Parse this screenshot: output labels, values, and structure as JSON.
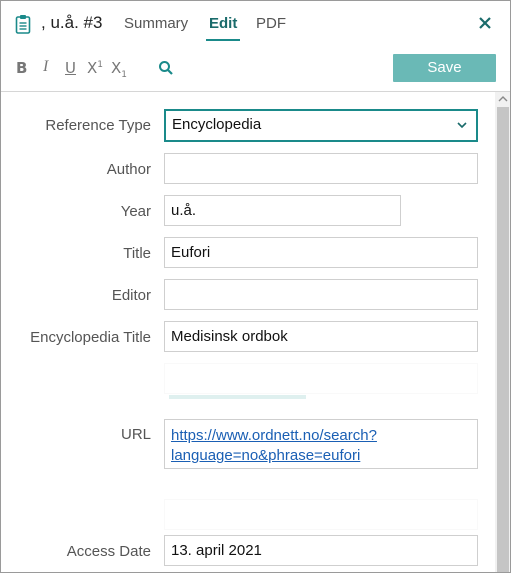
{
  "header": {
    "title": ", u.å. #3",
    "tabs": [
      {
        "label": "Summary"
      },
      {
        "label": "Edit"
      },
      {
        "label": "PDF"
      }
    ],
    "active_tab": "Edit",
    "accent_color": "#1a8a8a"
  },
  "toolbar": {
    "bold": "B",
    "italic": "I",
    "underline": "U",
    "superscript": "X",
    "superscript_mark": "1",
    "subscript": "X",
    "subscript_mark": "1",
    "save_label": "Save",
    "save_color": "#6ab9b6"
  },
  "form": {
    "reference_type": {
      "label": "Reference Type",
      "value": "Encyclopedia"
    },
    "author": {
      "label": "Author",
      "value": ""
    },
    "year": {
      "label": "Year",
      "value": "u.å."
    },
    "title": {
      "label": "Title",
      "value": "Eufori"
    },
    "editor": {
      "label": "Editor",
      "value": ""
    },
    "encyclopedia_title": {
      "label": "Encyclopedia Title",
      "value": "Medisinsk ordbok"
    },
    "url": {
      "label": "URL",
      "line1": "https://www.ordnett.no/search?",
      "line2": "language=no&phrase=eufori"
    },
    "access_date": {
      "label": "Access Date",
      "value": "13. april 2021"
    }
  },
  "icons": {
    "doc": "clipboard-icon",
    "close": "close-icon",
    "search": "search-icon",
    "dropdown": "chevron-down-icon"
  }
}
